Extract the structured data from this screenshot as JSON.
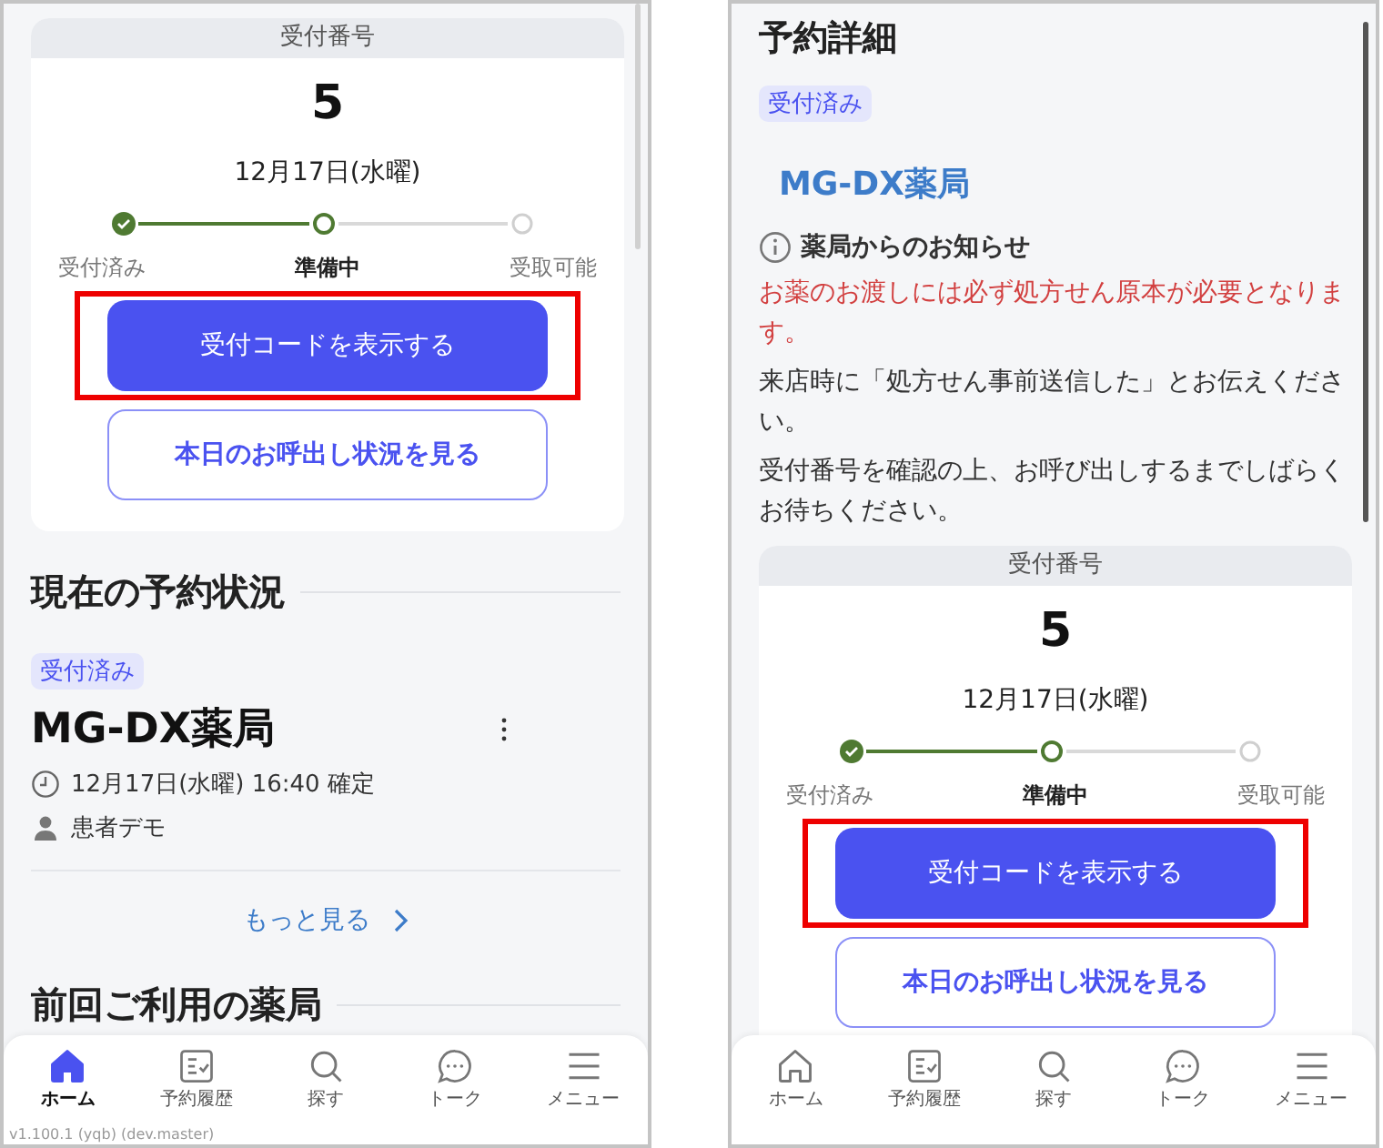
{
  "screens": [
    {
      "kind": "home",
      "receipt": {
        "header": "受付番号",
        "number": "5",
        "date": "12月17日(水曜)",
        "steps": [
          {
            "label": "受付済み",
            "completed": true,
            "selected": false
          },
          {
            "label": "準備中",
            "completed": false,
            "selected": true
          },
          {
            "label": "受取可能",
            "completed": false,
            "selected": false
          }
        ],
        "primary_button": {
          "label": "受付コードを表示する",
          "highlighted": true
        },
        "secondary_button": {
          "label": "本日のお呼出し状況を見る",
          "highlighted": false
        }
      },
      "current_section": {
        "title": "現在の予約状況",
        "badge": "受付済み",
        "pharmacy": "MG-DX薬局",
        "datetime": "12月17日(水曜) 16:40 確定",
        "patient": "患者デモ",
        "more_link": "もっと見る"
      },
      "previous_section": {
        "title": "前回ご利用の薬局"
      },
      "version": "v1.100.1 (yqb) (dev.master)",
      "nav": [
        {
          "label": "ホーム",
          "kind": "home",
          "selected": true
        },
        {
          "label": "予約履歴",
          "kind": "history",
          "selected": false
        },
        {
          "label": "探す",
          "kind": "search",
          "selected": false
        },
        {
          "label": "トーク",
          "kind": "chat",
          "selected": false
        },
        {
          "label": "メニュー",
          "kind": "menu",
          "selected": false
        }
      ]
    },
    {
      "kind": "detail",
      "title": "予約詳細",
      "badge": "受付済み",
      "pharmacy": "MG-DX薬局",
      "notice": {
        "title": "薬局からのお知らせ",
        "paragraphs": [
          {
            "text": "お薬のお渡しには必ず処方せん原本が必要となります。",
            "important": true
          },
          {
            "text": "来店時に「処方せん事前送信した」とお伝えください。",
            "important": false
          },
          {
            "text": "受付番号を確認の上、お呼び出しするまでしばらくお待ちください。",
            "important": false
          }
        ]
      },
      "receipt": {
        "header": "受付番号",
        "number": "5",
        "date": "12月17日(水曜)",
        "steps": [
          {
            "label": "受付済み",
            "completed": true,
            "selected": false
          },
          {
            "label": "準備中",
            "completed": false,
            "selected": true
          },
          {
            "label": "受取可能",
            "completed": false,
            "selected": false
          }
        ],
        "primary_button": {
          "label": "受付コードを表示する",
          "highlighted": true
        },
        "secondary_button": {
          "label": "本日のお呼出し状況を見る",
          "highlighted": false
        }
      },
      "nav": [
        {
          "label": "ホーム",
          "kind": "home",
          "selected": false
        },
        {
          "label": "予約履歴",
          "kind": "history",
          "selected": false
        },
        {
          "label": "探す",
          "kind": "search",
          "selected": false
        },
        {
          "label": "トーク",
          "kind": "chat",
          "selected": false
        },
        {
          "label": "メニュー",
          "kind": "menu",
          "selected": false
        }
      ]
    }
  ]
}
